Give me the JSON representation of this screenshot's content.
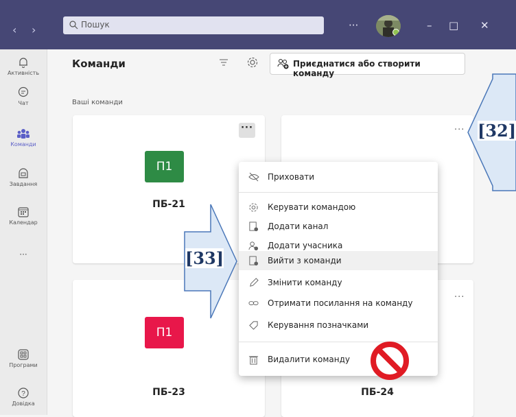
{
  "titlebar": {
    "back": "‹",
    "forward": "›",
    "search_placeholder": "Пошук",
    "more": "···",
    "minimize": "–",
    "maximize": "□",
    "close": "✕"
  },
  "rail": [
    {
      "label": "Активність",
      "icon": "bell-icon"
    },
    {
      "label": "Чат",
      "icon": "chat-icon"
    },
    {
      "label": "Команди",
      "icon": "teams-icon"
    },
    {
      "label": "Завдання",
      "icon": "assignments-icon"
    },
    {
      "label": "Календар",
      "icon": "calendar-icon"
    },
    {
      "label": "···",
      "icon": "more-icon"
    },
    {
      "label": "Програми",
      "icon": "apps-icon"
    },
    {
      "label": "Довідка",
      "icon": "help-icon"
    }
  ],
  "header": {
    "title": "Команди",
    "join_button": "Приєднатися або створити команду"
  },
  "section_label": "Ваші команди",
  "teams": [
    {
      "name": "ПБ-21",
      "tile": "П1",
      "color": "#2e8b45"
    },
    {
      "name": "",
      "tile": "",
      "color": ""
    },
    {
      "name": "ПБ-23",
      "tile": "П1",
      "color": "#e8174a"
    },
    {
      "name": "ПБ-24",
      "tile": "",
      "color": ""
    }
  ],
  "card_more": "···",
  "menu": [
    {
      "label": "Приховати",
      "icon": "hide-icon"
    },
    {
      "label": "Керувати командою",
      "icon": "gear-icon"
    },
    {
      "label": "Додати канал",
      "icon": "add-channel-icon"
    },
    {
      "label": "Додати учасника",
      "icon": "add-member-icon"
    },
    {
      "label": "Вийти з команди",
      "icon": "leave-icon"
    },
    {
      "label": "Змінити команду",
      "icon": "edit-icon"
    },
    {
      "label": "Отримати посилання на команду",
      "icon": "link-icon"
    },
    {
      "label": "Керування позначками",
      "icon": "tag-icon"
    },
    {
      "label": "Видалити команду",
      "icon": "trash-icon"
    }
  ],
  "annotations": {
    "label_32": "[32]",
    "label_33": "[33]"
  },
  "colors": {
    "titlebar": "#464775",
    "accent": "#5b5fc7",
    "arrow_fill": "#dce8f6",
    "arrow_stroke": "#4a77b8",
    "prohibit": "#e01b24"
  }
}
